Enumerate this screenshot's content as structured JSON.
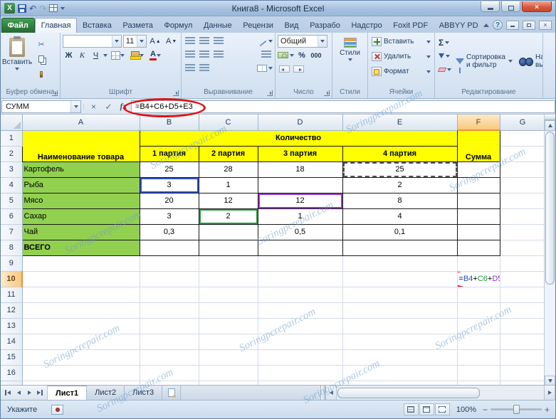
{
  "window": {
    "title": "Книга8  -  Microsoft Excel"
  },
  "icons": {
    "excel_logo": "X",
    "close": "×",
    "help": "?",
    "cut": "✂",
    "undo": "↶",
    "redo": "↷",
    "check": "✓",
    "cancel": "×",
    "autosum": "Σ",
    "minus": "−",
    "plus": "+"
  },
  "tabs": {
    "file": "Файл",
    "main": [
      {
        "label": "Главная",
        "active": true
      },
      {
        "label": "Вставка"
      },
      {
        "label": "Размета"
      },
      {
        "label": "Формул"
      },
      {
        "label": "Данные"
      },
      {
        "label": "Рецензи"
      },
      {
        "label": "Вид"
      },
      {
        "label": "Разрабо"
      },
      {
        "label": "Надстро"
      },
      {
        "label": "Foxit PDF"
      },
      {
        "label": "ABBYY PD"
      }
    ]
  },
  "ribbon": {
    "clipboard": {
      "label": "Буфер обмена",
      "paste": "Вставить"
    },
    "font": {
      "label": "Шрифт",
      "name": "",
      "size": "11",
      "bold": "Ж",
      "italic": "К",
      "underline": "Ч",
      "letter": "А"
    },
    "alignment": {
      "label": "Выравнивание"
    },
    "number": {
      "label": "Число",
      "format": "Общий",
      "percent": "%",
      "thousands": "000"
    },
    "styles": {
      "label": "Стили",
      "button": "Стили"
    },
    "cells": {
      "label": "Ячейки",
      "insert": "Вставить",
      "remove": "Удалить",
      "format": "Формат"
    },
    "editing": {
      "label": "Редактирование",
      "sort": "Сортировка и фильтр",
      "find": "Найти и выделить"
    }
  },
  "formula_bar": {
    "name_box": "СУММ",
    "fx": "fx",
    "formula": "=B4+C6+D5+E3"
  },
  "sheet": {
    "col_headers": [
      "A",
      "B",
      "C",
      "D",
      "E",
      "F",
      "G"
    ],
    "row_numbers": [
      "1",
      "2",
      "3",
      "4",
      "5",
      "6",
      "7",
      "8",
      "9",
      "10",
      "11",
      "12",
      "13",
      "14",
      "15",
      "16"
    ],
    "name_header": "Наименование товара",
    "quantity_header": "Количество",
    "sum_header": "Сумма",
    "party_headers": [
      "1 партия",
      "2 партия",
      "3 партия",
      "4 партия"
    ],
    "items": [
      {
        "name": "Картофель",
        "v": [
          "25",
          "28",
          "18",
          "25"
        ]
      },
      {
        "name": "Рыба",
        "v": [
          "3",
          "1",
          "",
          "2"
        ]
      },
      {
        "name": "Мясо",
        "v": [
          "20",
          "12",
          "12",
          "8"
        ]
      },
      {
        "name": "Сахар",
        "v": [
          "3",
          "2",
          "1",
          "4"
        ]
      },
      {
        "name": "Чай",
        "v": [
          "0,3",
          "",
          "0,5",
          "0,1"
        ]
      },
      {
        "name": "ВСЕГО",
        "v": [
          "",
          "",
          "",
          ""
        ]
      }
    ],
    "active_cell": "F10",
    "edit_formula": {
      "eq": "=",
      "ref1": "B4",
      "op1": "+",
      "ref2": "C6",
      "op2": "+",
      "ref3": "D5",
      "op3": "+",
      "ref4": "E3"
    },
    "ref_colors": {
      "ref1": "#2b50c8",
      "ref2": "#1e9e3c",
      "ref3": "#9b30c8",
      "ref4": "#333333"
    }
  },
  "sheet_tabs": {
    "items": [
      "Лист1",
      "Лист2",
      "Лист3"
    ],
    "active": "Лист1"
  },
  "status": {
    "mode": "Укажите",
    "zoom": "100%"
  },
  "watermark": {
    "text": "Soringpcrepair.com"
  },
  "colors": {
    "fill_yellow": "#ffff00",
    "fill_green": "#92d050",
    "header_highlight": "#f8c87f",
    "oval_red": "#e01212",
    "file_tab_green": "#2e7d3c"
  }
}
